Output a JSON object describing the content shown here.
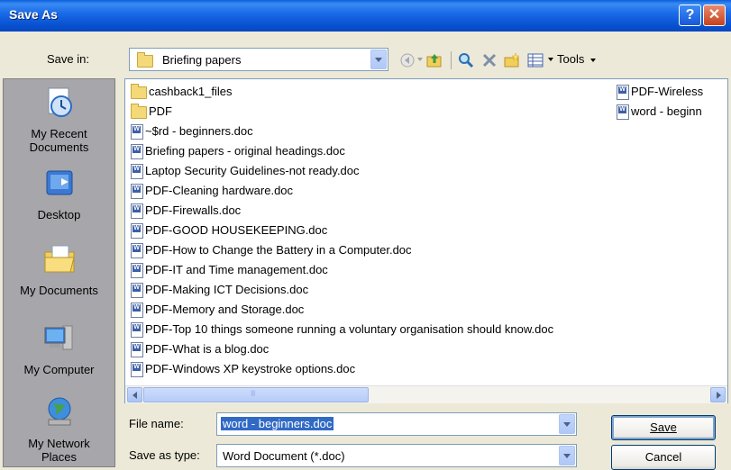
{
  "window": {
    "title": "Save As"
  },
  "toolbar": {
    "save_in_label": "Save in:",
    "current_folder": "Briefing papers",
    "tools_label": "Tools"
  },
  "places": [
    {
      "label": "My Recent Documents"
    },
    {
      "label": "Desktop"
    },
    {
      "label": "My Documents"
    },
    {
      "label": "My Computer"
    },
    {
      "label": "My Network Places"
    }
  ],
  "files": {
    "column1": [
      {
        "name": "cashback1_files",
        "type": "folder"
      },
      {
        "name": "PDF",
        "type": "folder"
      },
      {
        "name": "~$rd - beginners.doc",
        "type": "doc"
      },
      {
        "name": "Briefing papers - original headings.doc",
        "type": "doc"
      },
      {
        "name": "Laptop Security Guidelines-not ready.doc",
        "type": "doc"
      },
      {
        "name": "PDF-Cleaning hardware.doc",
        "type": "doc"
      },
      {
        "name": "PDF-Firewalls.doc",
        "type": "doc"
      },
      {
        "name": "PDF-GOOD HOUSEKEEPING.doc",
        "type": "doc"
      },
      {
        "name": "PDF-How to Change the Battery in a Computer.doc",
        "type": "doc"
      },
      {
        "name": "PDF-IT and Time management.doc",
        "type": "doc"
      },
      {
        "name": "PDF-Making ICT Decisions.doc",
        "type": "doc"
      },
      {
        "name": "PDF-Memory and Storage.doc",
        "type": "doc"
      },
      {
        "name": "PDF-Top 10 things someone running a voluntary organisation should know.doc",
        "type": "doc"
      },
      {
        "name": "PDF-What is a blog.doc",
        "type": "doc"
      },
      {
        "name": "PDF-Windows XP keystroke options.doc",
        "type": "doc"
      }
    ],
    "column2": [
      {
        "name": "PDF-Wireless",
        "type": "doc"
      },
      {
        "name": "word - beginn",
        "type": "doc"
      }
    ]
  },
  "form": {
    "file_name_label": "File name:",
    "file_name_value": "word - beginners.doc",
    "save_as_type_label": "Save as type:",
    "save_as_type_value": "Word Document (*.doc)",
    "save_button": "Save",
    "cancel_button": "Cancel"
  },
  "scrollbar": {
    "grip": "III"
  }
}
